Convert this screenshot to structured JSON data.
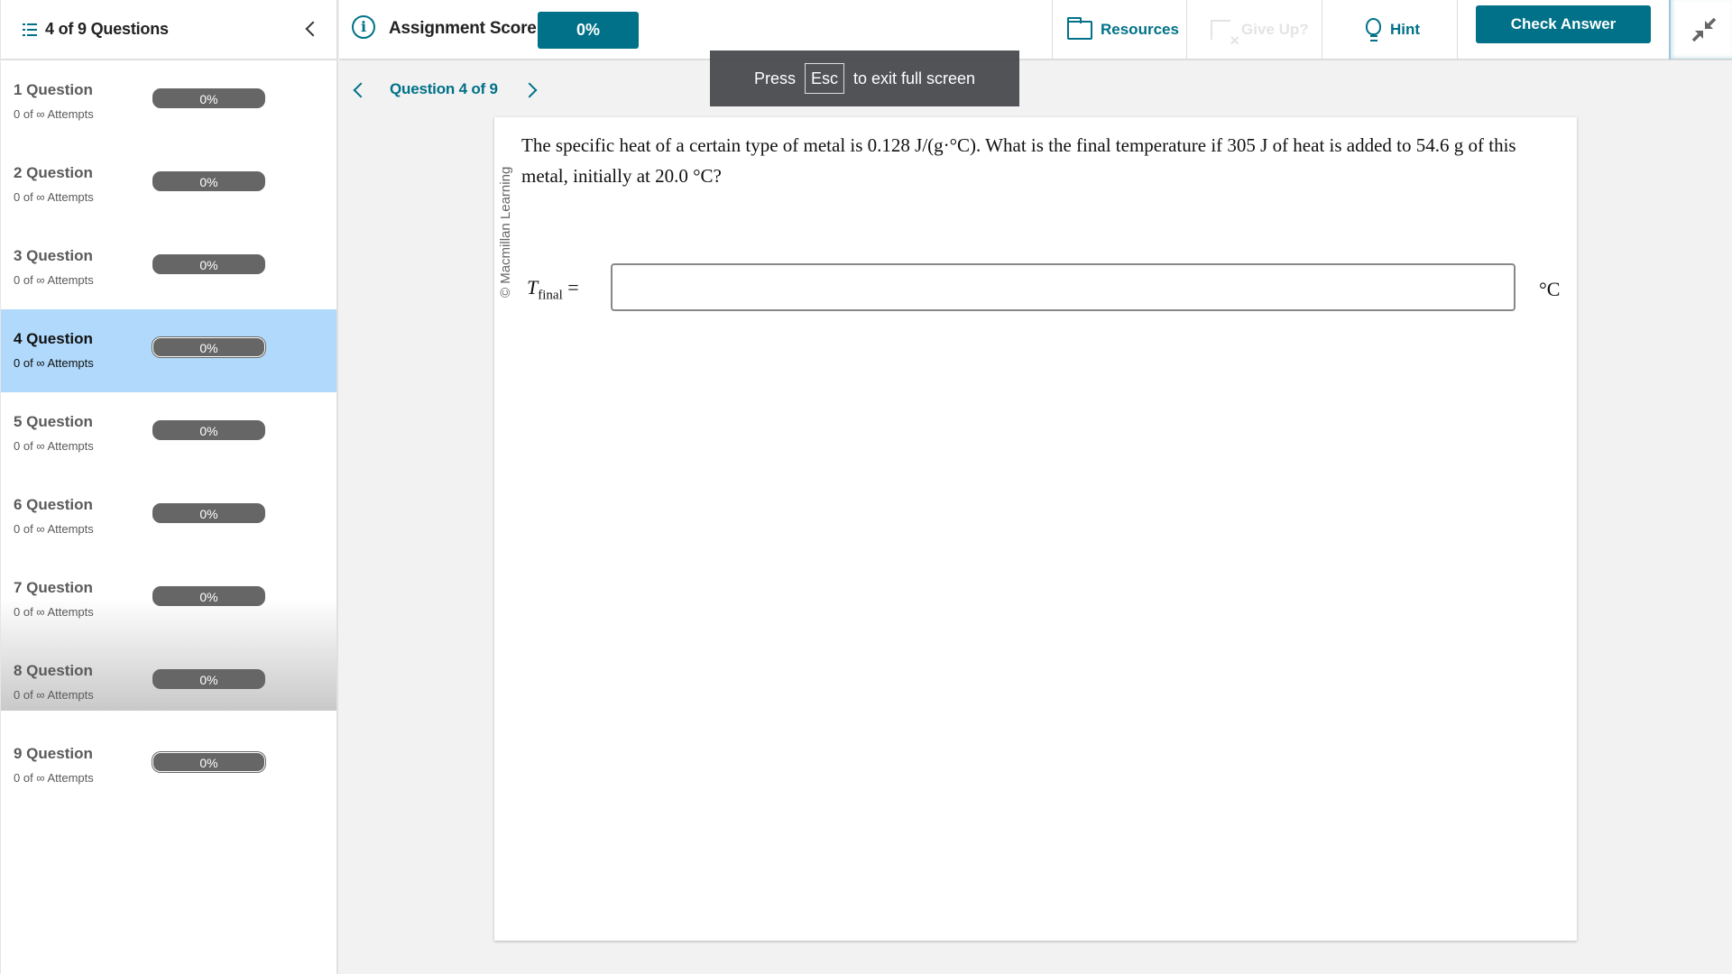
{
  "sidebar": {
    "title": "4 of 9 Questions",
    "list_icon": "list-icon",
    "collapse_icon": "chevron-left-icon",
    "questions": [
      {
        "label": "1 Question",
        "attempts": "0 of ∞ Attempts",
        "score": "0%"
      },
      {
        "label": "2 Question",
        "attempts": "0 of ∞ Attempts",
        "score": "0%"
      },
      {
        "label": "3 Question",
        "attempts": "0 of ∞ Attempts",
        "score": "0%"
      },
      {
        "label": "4 Question",
        "attempts": "0 of ∞ Attempts",
        "score": "0%",
        "selected": true
      },
      {
        "label": "5 Question",
        "attempts": "0 of ∞ Attempts",
        "score": "0%"
      },
      {
        "label": "6 Question",
        "attempts": "0 of ∞ Attempts",
        "score": "0%"
      },
      {
        "label": "7 Question",
        "attempts": "0 of ∞ Attempts",
        "score": "0%"
      },
      {
        "label": "8 Question",
        "attempts": "0 of ∞ Attempts",
        "score": "0%"
      },
      {
        "label": "9 Question",
        "attempts": "0 of ∞ Attempts",
        "score": "0%"
      }
    ]
  },
  "topbar": {
    "info_icon": "info-icon",
    "score_label": "Assignment Score:",
    "score_value": "0%",
    "resources_label": "Resources",
    "giveup_label": "Give Up?",
    "hint_label": "Hint",
    "check_answer_label": "Check Answer",
    "exit_fullscreen_icon": "collapse-arrows-icon"
  },
  "nav": {
    "label": "Question 4 of 9"
  },
  "toast": {
    "prefix": "Press",
    "key": "Esc",
    "suffix": "to exit full screen"
  },
  "question": {
    "copyright": "© Macmillan Learning",
    "text": "The specific heat of a certain type of metal is 0.128 J/(g·°C). What is the final temperature if 305 J of heat is added to 54.6 g of this metal, initially at 20.0 °C?",
    "answer_var": "T",
    "answer_sub": "final",
    "answer_eq": " =",
    "answer_value": "",
    "answer_unit": "°C"
  },
  "colors": {
    "accent": "#007188",
    "selected_bg": "#b0d9fb",
    "progress_bar": "#666666"
  }
}
